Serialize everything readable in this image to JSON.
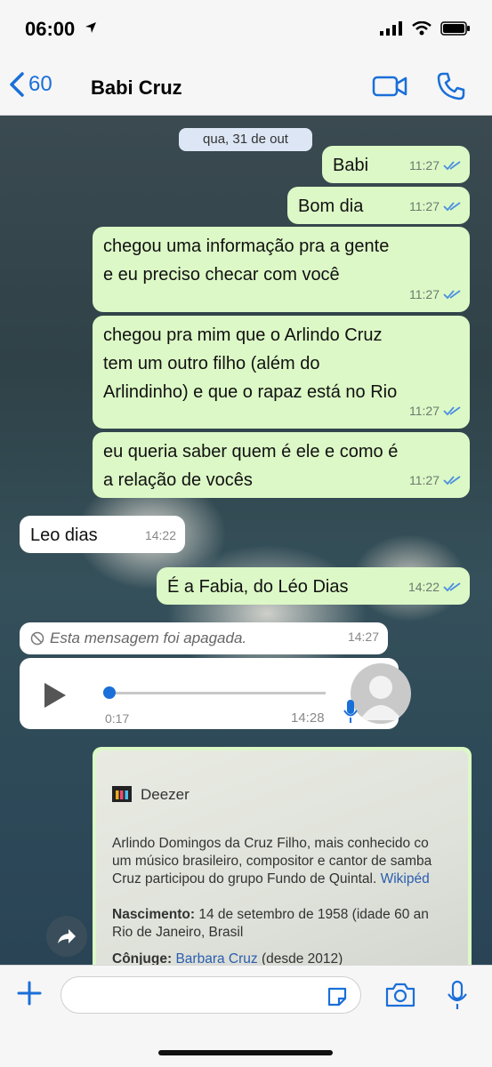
{
  "status": {
    "time": "06:00"
  },
  "nav": {
    "back_count": "60",
    "contact_name": "Babi Cruz"
  },
  "chat": {
    "date_chip": "qua, 31 de out",
    "messages": [
      {
        "text": "Babi",
        "time": "11:27"
      },
      {
        "text": "Bom dia",
        "time": "11:27"
      },
      {
        "line1": "chegou uma informação pra a gente",
        "line2": "e eu preciso checar com você",
        "time": "11:27"
      },
      {
        "line1": "chegou pra mim que o Arlindo Cruz",
        "line2": "tem um outro filho (além do",
        "line3": "Arlindinho) e que o rapaz está  no Rio",
        "time": "11:27"
      },
      {
        "line1": "eu queria saber quem é ele e como é",
        "line2": "a relação de vocês",
        "time": "11:27"
      },
      {
        "text": "Leo dias",
        "time": "14:22"
      },
      {
        "text": "É a Fabia, do Léo Dias",
        "time": "14:22"
      },
      {
        "text": "Esta mensagem foi apagada.",
        "time": "14:27"
      }
    ],
    "audio": {
      "duration": "0:17",
      "time": "14:28"
    },
    "image": {
      "title": "Deezer",
      "line1": "Arlindo Domingos da Cruz Filho, mais conhecido co",
      "line2": "um músico brasileiro, compositor e cantor de samba",
      "line3a": "Cruz participou do grupo Fundo de Quintal. ",
      "line3b": "Wikipéd",
      "birth_label": "Nascimento:",
      "birth_value": " 14 de setembro de 1958 (idade 60 an",
      "birth_place": "Rio de Janeiro, Brasil",
      "spouse_label": "Cônjuge:",
      "spouse_name": "Barbara Cruz",
      "spouse_since": " (desde 2012)"
    }
  },
  "colors": {
    "accent": "#1a6fd9",
    "outgoing_bubble": "#dcf8c6",
    "incoming_bubble": "#ffffff",
    "read_ticks": "#4a8fe0"
  }
}
